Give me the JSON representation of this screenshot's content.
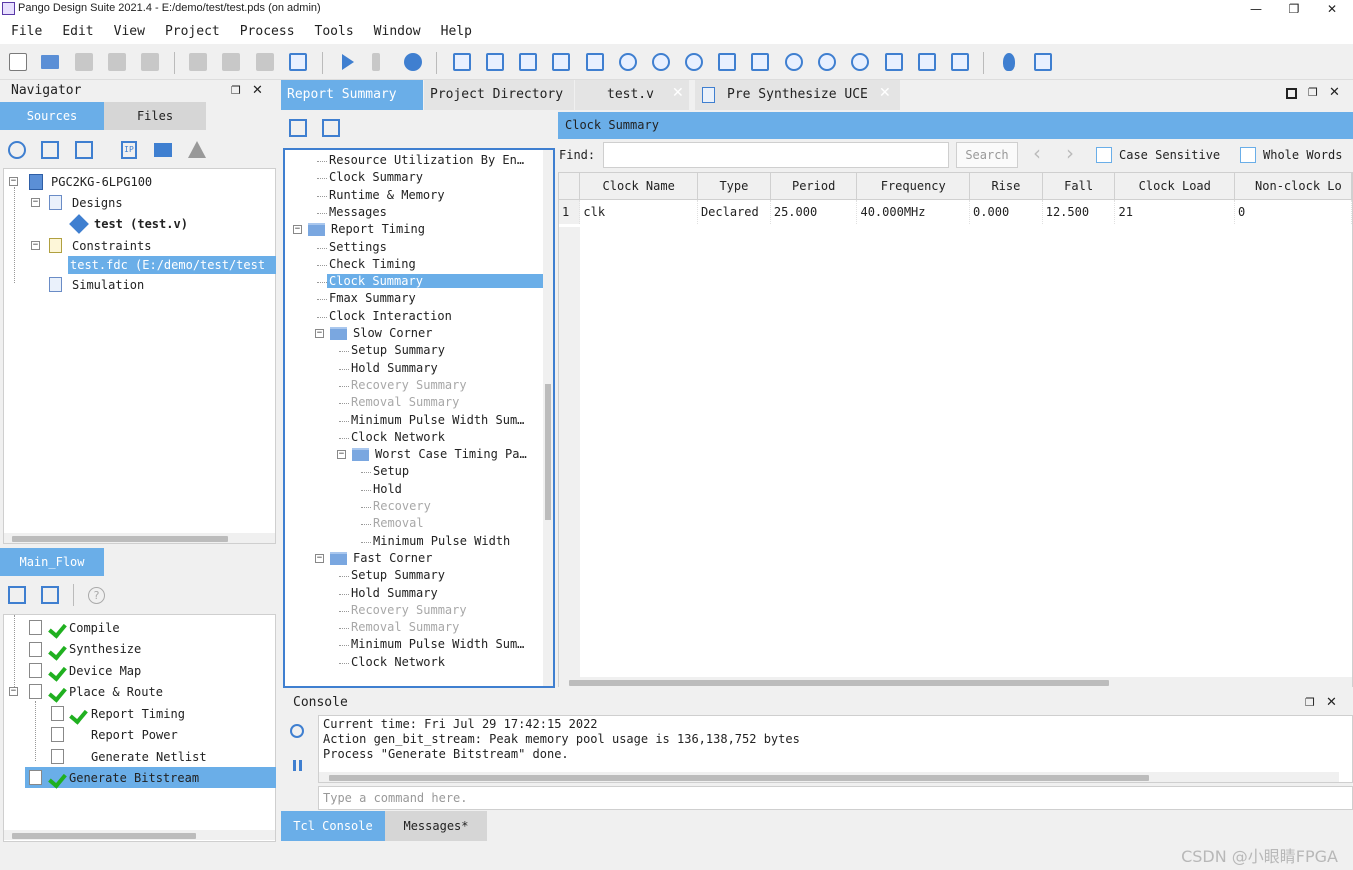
{
  "window": {
    "title": "Pango Design Suite 2021.4 - E:/demo/test/test.pds (on admin)",
    "minimize": "—",
    "restore": "❐",
    "close": "✕"
  },
  "menu": [
    "File",
    "Edit",
    "View",
    "Project",
    "Process",
    "Tools",
    "Window",
    "Help"
  ],
  "navigator": {
    "title": "Navigator",
    "tabs": [
      "Sources",
      "Files"
    ],
    "tree": {
      "root": "PGC2KG-6LPG100",
      "designs": "Designs",
      "design_item": "test (test.v)",
      "constraints": "Constraints",
      "constraint_item": "test.fdc (E:/demo/test/test",
      "simulation": "Simulation"
    }
  },
  "main_flow": {
    "tab": "Main_Flow",
    "steps": [
      {
        "label": "Compile",
        "done": true
      },
      {
        "label": "Synthesize",
        "done": true
      },
      {
        "label": "Device Map",
        "done": true
      },
      {
        "label": "Place & Route",
        "done": true
      },
      {
        "label": "Report Timing",
        "done": true
      },
      {
        "label": "Report Power",
        "done": false
      },
      {
        "label": "Generate Netlist",
        "done": false
      },
      {
        "label": "Generate Bitstream",
        "done": true
      }
    ]
  },
  "doc_tabs": [
    "Report Summary",
    "Project Directory",
    "test.v",
    "Pre Synthesize UCE"
  ],
  "report_tree": [
    {
      "label": "Resource Utilization By En…",
      "level": 1,
      "enabled": true
    },
    {
      "label": "Clock Summary",
      "level": 1,
      "enabled": true
    },
    {
      "label": "Runtime & Memory",
      "level": 1,
      "enabled": true
    },
    {
      "label": "Messages",
      "level": 1,
      "enabled": true
    },
    {
      "label": "Report Timing",
      "level": 0,
      "folder": true,
      "enabled": true
    },
    {
      "label": "Settings",
      "level": 1,
      "enabled": true
    },
    {
      "label": "Check Timing",
      "level": 1,
      "enabled": true
    },
    {
      "label": "Clock Summary",
      "level": 1,
      "enabled": true,
      "selected": true
    },
    {
      "label": "Fmax Summary",
      "level": 1,
      "enabled": true
    },
    {
      "label": "Clock Interaction",
      "level": 1,
      "enabled": true
    },
    {
      "label": "Slow Corner",
      "level": 1,
      "folder": true,
      "enabled": true
    },
    {
      "label": "Setup Summary",
      "level": 2,
      "enabled": true
    },
    {
      "label": "Hold Summary",
      "level": 2,
      "enabled": true
    },
    {
      "label": "Recovery Summary",
      "level": 2,
      "enabled": false
    },
    {
      "label": "Removal Summary",
      "level": 2,
      "enabled": false
    },
    {
      "label": "Minimum Pulse Width Sum…",
      "level": 2,
      "enabled": true
    },
    {
      "label": "Clock Network",
      "level": 2,
      "enabled": true
    },
    {
      "label": "Worst Case Timing Pa…",
      "level": 2,
      "folder": true,
      "enabled": true
    },
    {
      "label": "Setup",
      "level": 3,
      "enabled": true
    },
    {
      "label": "Hold",
      "level": 3,
      "enabled": true
    },
    {
      "label": "Recovery",
      "level": 3,
      "enabled": false
    },
    {
      "label": "Removal",
      "level": 3,
      "enabled": false
    },
    {
      "label": "Minimum Pulse Width",
      "level": 3,
      "enabled": true
    },
    {
      "label": "Fast Corner",
      "level": 1,
      "folder": true,
      "enabled": true
    },
    {
      "label": "Setup Summary",
      "level": 2,
      "enabled": true
    },
    {
      "label": "Hold Summary",
      "level": 2,
      "enabled": true
    },
    {
      "label": "Recovery Summary",
      "level": 2,
      "enabled": false
    },
    {
      "label": "Removal Summary",
      "level": 2,
      "enabled": false
    },
    {
      "label": "Minimum Pulse Width Sum…",
      "level": 2,
      "enabled": true
    },
    {
      "label": "Clock Network",
      "level": 2,
      "enabled": true
    }
  ],
  "clock_summary": {
    "title": "Clock Summary",
    "find_label": "Find:",
    "find_value": "",
    "search_button": "Search",
    "case_sensitive": "Case Sensitive",
    "whole_words": "Whole Words",
    "columns": [
      "Clock Name",
      "Type",
      "Period",
      "Frequency",
      "Rise",
      "Fall",
      "Clock Load",
      "Non-clock Lo"
    ],
    "rows": [
      {
        "index": "1",
        "cells": [
          "clk",
          "Declared",
          "25.000",
          "40.000MHz",
          "0.000",
          "12.500",
          "21",
          "0"
        ]
      }
    ]
  },
  "console": {
    "title": "Console",
    "lines": [
      "Current time: Fri Jul 29 17:42:15 2022",
      "Action gen_bit_stream: Peak memory pool usage is 136,138,752 bytes",
      "Process \"Generate Bitstream\" done."
    ],
    "placeholder": "Type a command here.",
    "tabs": [
      "Tcl Console",
      "Messages*"
    ]
  },
  "watermark": "CSDN @小眼睛FPGA"
}
